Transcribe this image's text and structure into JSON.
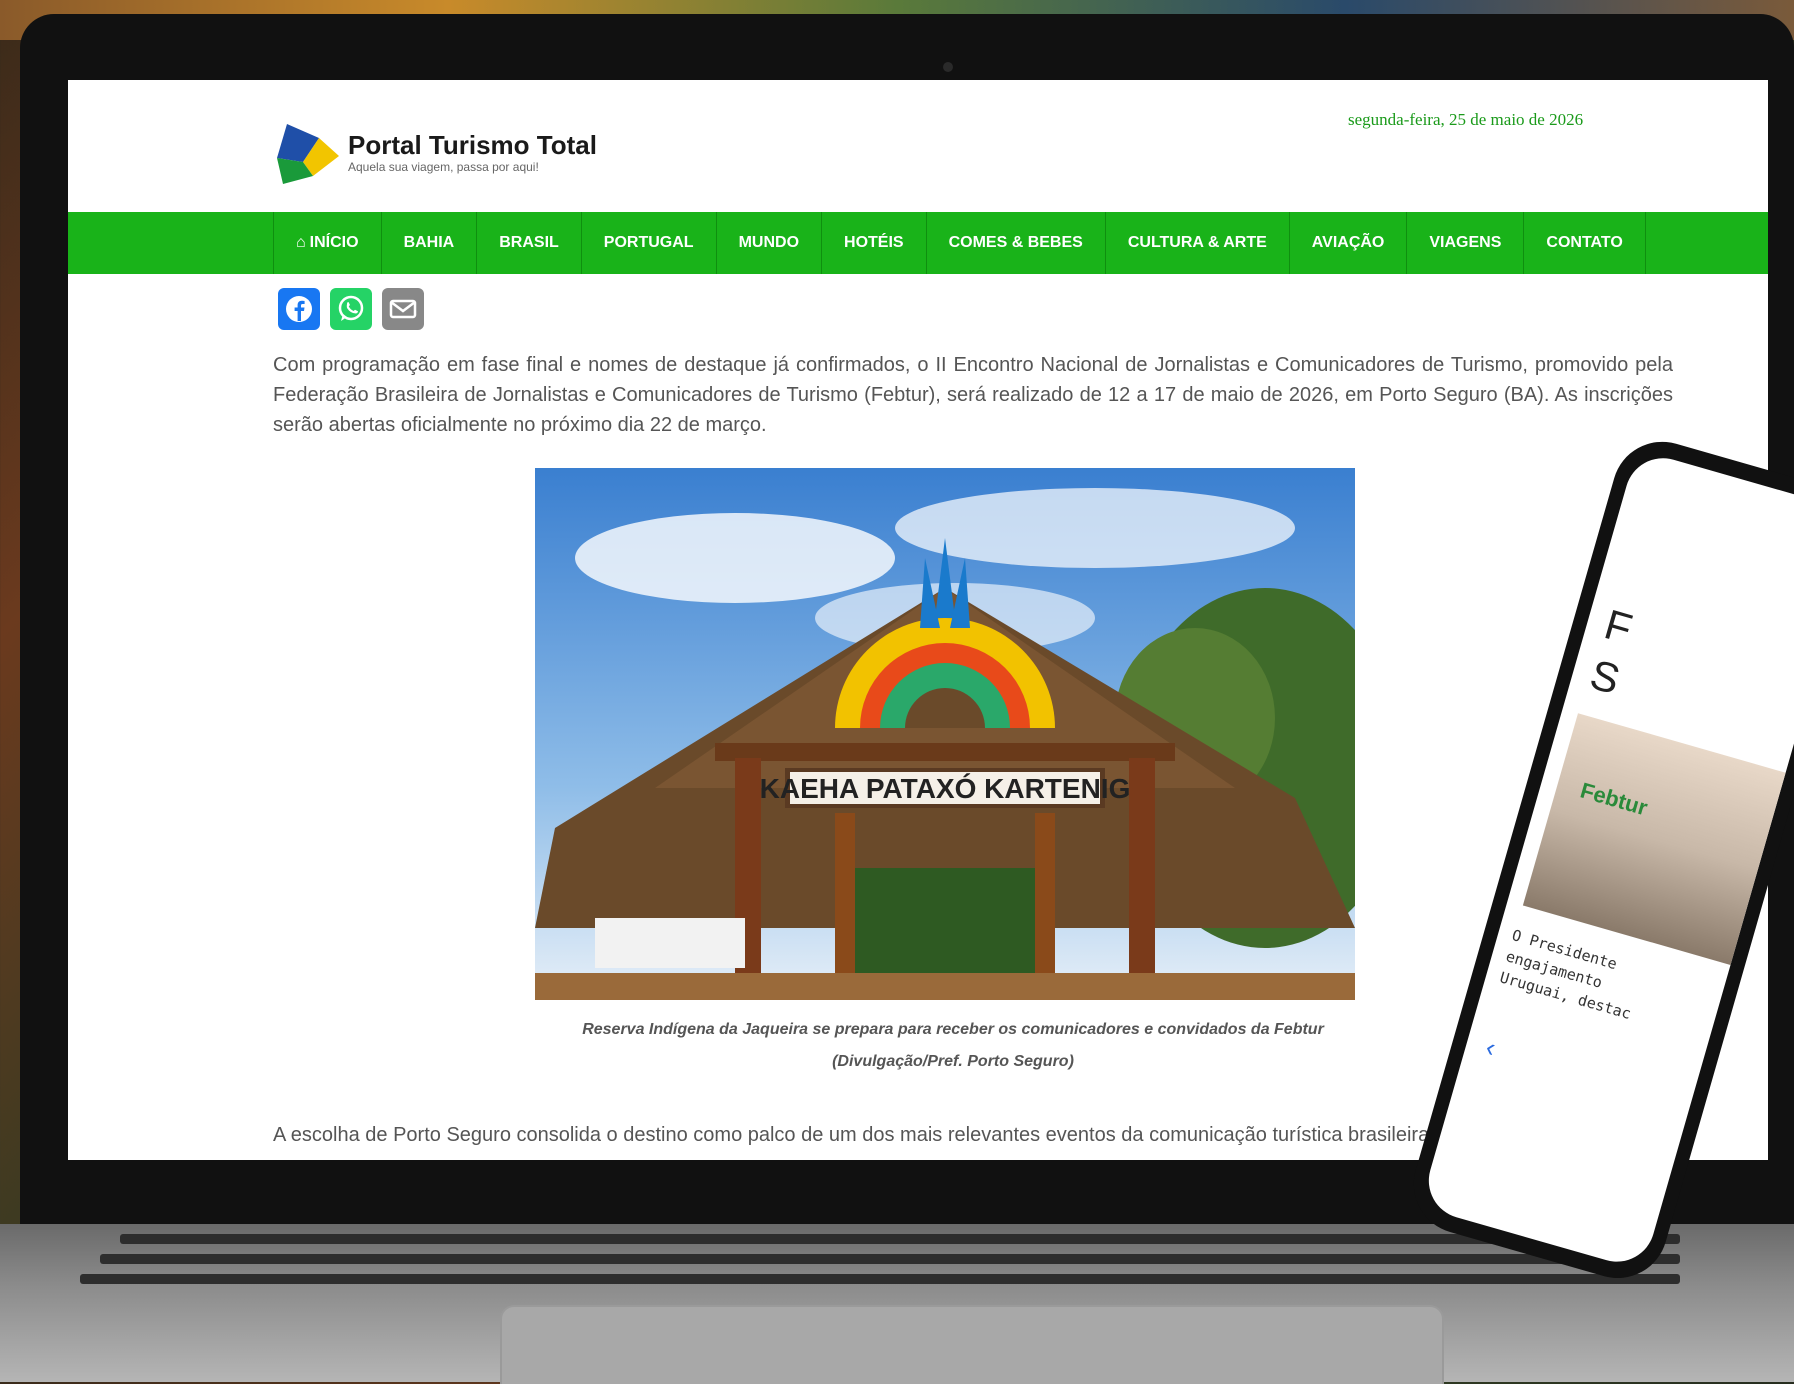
{
  "site": {
    "name": "Portal Turismo Total",
    "tagline": "Aquela sua viagem, passa por aqui!",
    "date": "segunda-feira, 25 de maio de 2026"
  },
  "nav": {
    "items": [
      {
        "label": "INÍCIO",
        "icon": "home-icon"
      },
      {
        "label": "BAHIA"
      },
      {
        "label": "BRASIL"
      },
      {
        "label": "PORTUGAL"
      },
      {
        "label": "MUNDO"
      },
      {
        "label": "HOTÉIS"
      },
      {
        "label": "COMES & BEBES"
      },
      {
        "label": "CULTURA & ARTE"
      },
      {
        "label": "AVIAÇÃO"
      },
      {
        "label": "VIAGENS"
      },
      {
        "label": "CONTATO"
      }
    ]
  },
  "share": {
    "icons": [
      "facebook-icon",
      "whatsapp-icon",
      "email-icon"
    ],
    "colors": {
      "facebook": "#1877f2",
      "whatsapp": "#25d366",
      "email": "#888888"
    }
  },
  "article": {
    "paragraph1": "Com programação em fase final e nomes de destaque já confirmados, o II Encontro Nacional de Jornalistas e Comunicadores de Turismo, promovido pela Federação Brasileira de Jornalistas e Comunicadores de Turismo (Febtur), será realizado de 12 a 17 de maio de 2026, em Porto Seguro (BA). As inscrições serão abertas oficialmente no próximo dia 22 de março.",
    "image_sign": "KAEHA PATAXÓ KARTENIG",
    "caption_line1": "Reserva Indígena da Jaqueira se prepara para receber os comunicadores e convidados da Febtur",
    "caption_line2": "(Divulgação/Pref. Porto Seguro)",
    "paragraph2": "A escolha de Porto Seguro consolida o destino como palco de um dos mais relevantes eventos da comunicação turística brasileira."
  },
  "phone": {
    "title": "F\nS",
    "image_label": "Febtur",
    "text": "O Presidente\nengajamento\nUruguai, destac"
  },
  "colors": {
    "nav_green": "#19b319",
    "date_green": "#1a9a1a"
  }
}
